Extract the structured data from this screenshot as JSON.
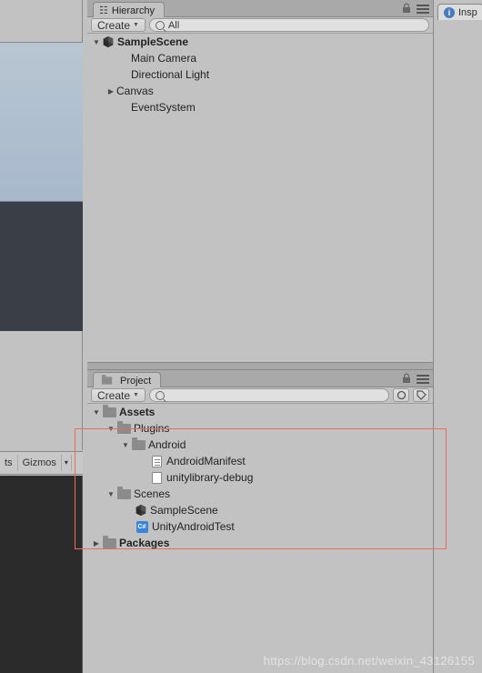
{
  "left": {
    "toolbar_items": [
      "ts",
      "Gizmos"
    ]
  },
  "hierarchy": {
    "tab_label": "Hierarchy",
    "create_label": "Create",
    "search_value": "All",
    "scene_name": "SampleScene",
    "items": [
      {
        "label": "Main Camera",
        "arrow": "none",
        "indent": 2
      },
      {
        "label": "Directional Light",
        "arrow": "none",
        "indent": 2
      },
      {
        "label": "Canvas",
        "arrow": "right",
        "indent": 2
      },
      {
        "label": "EventSystem",
        "arrow": "none",
        "indent": 2
      }
    ]
  },
  "project": {
    "tab_label": "Project",
    "create_label": "Create",
    "tree": {
      "assets": {
        "label": "Assets"
      },
      "plugins": {
        "label": "Plugins"
      },
      "android": {
        "label": "Android"
      },
      "manifest": {
        "label": "AndroidManifest"
      },
      "unitylib": {
        "label": "unitylibrary-debug"
      },
      "scenes": {
        "label": "Scenes"
      },
      "samplescene": {
        "label": "SampleScene"
      },
      "unityandroidtest": {
        "label": "UnityAndroidTest"
      },
      "packages": {
        "label": "Packages"
      }
    }
  },
  "inspector": {
    "tab_label": "Insp"
  },
  "watermark": "https://blog.csdn.net/weixin_43126155"
}
